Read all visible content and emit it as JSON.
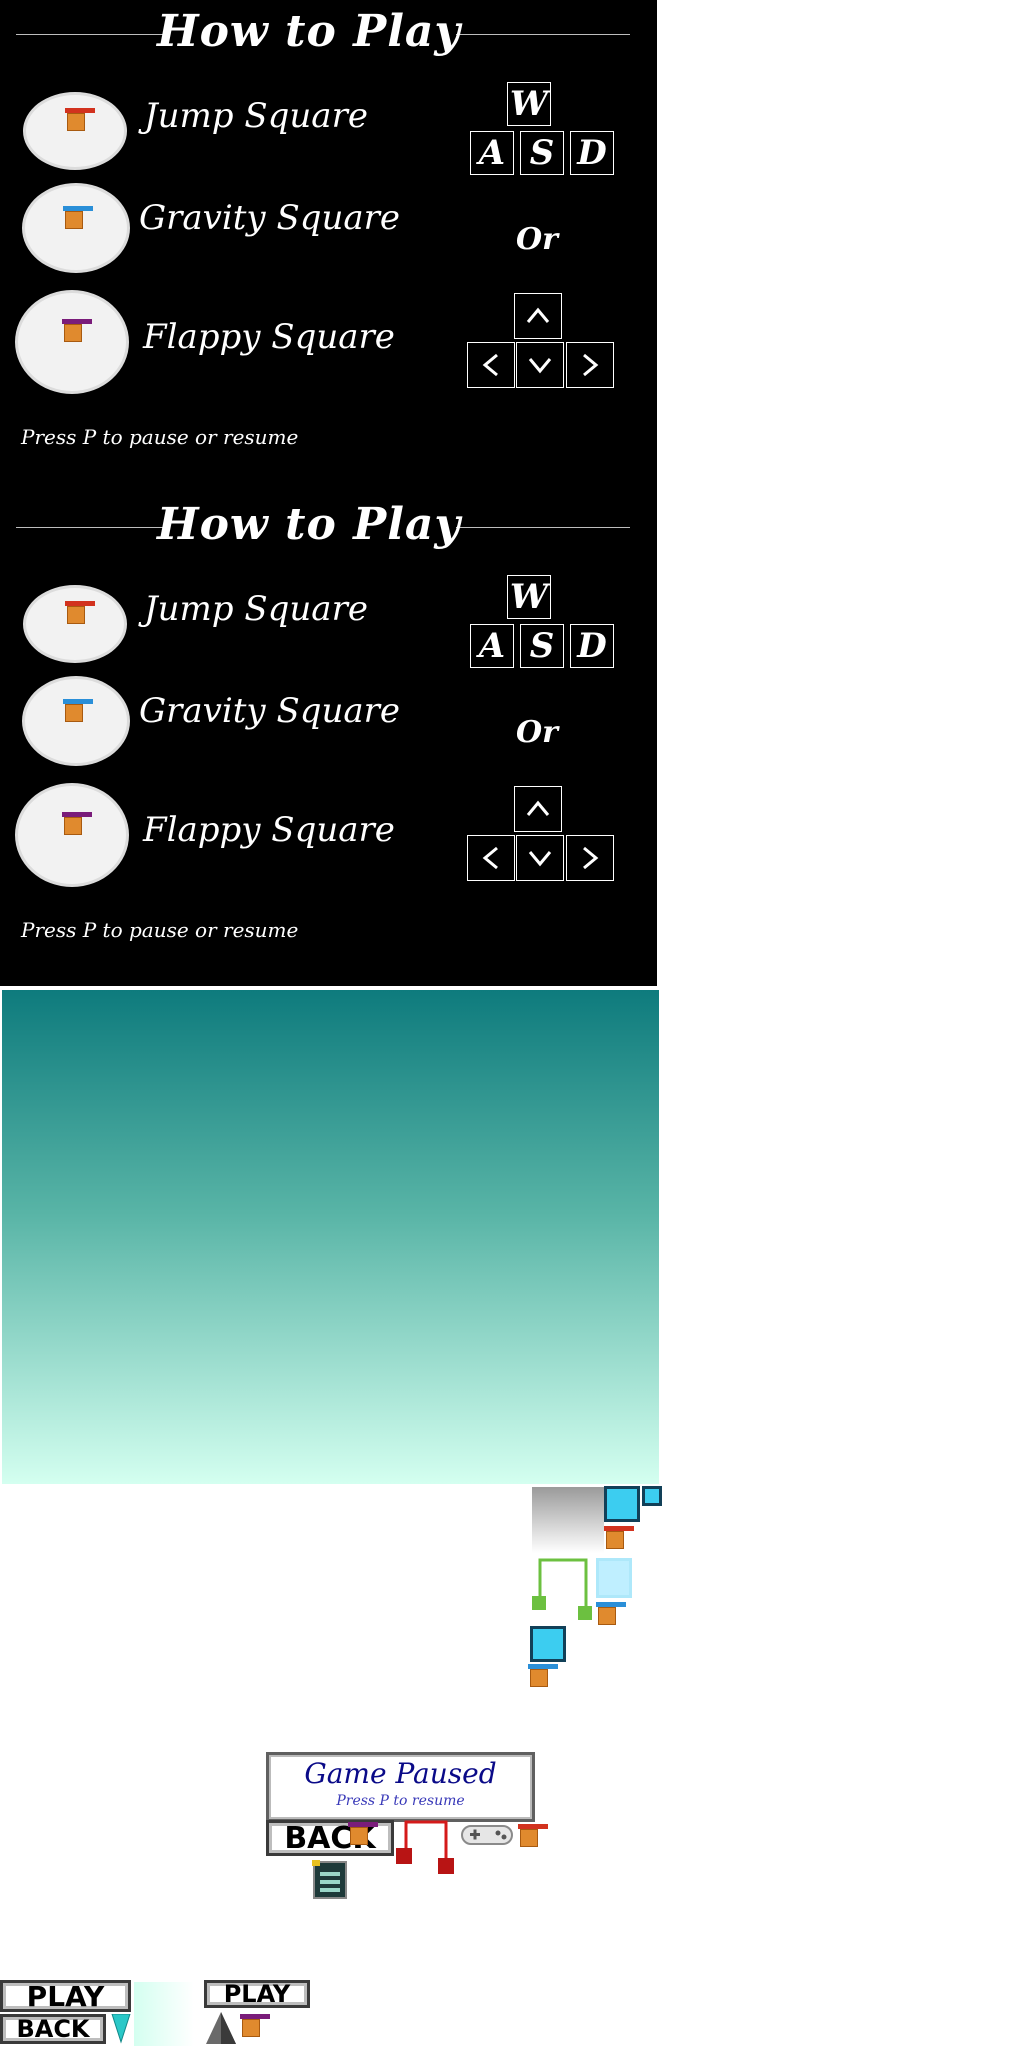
{
  "how_to_play": {
    "title": "How to Play",
    "modes": [
      {
        "label": "Jump Square",
        "cap_color": "#d2321e"
      },
      {
        "label": "Gravity Square",
        "cap_color": "#2a8fd8"
      },
      {
        "label": "Flappy Square",
        "cap_color": "#7a1c7a"
      }
    ],
    "wasd_keys": [
      "W",
      "A",
      "S",
      "D"
    ],
    "or_label": "Or",
    "arrow_keys": [
      "up-arrow-icon",
      "left-arrow-icon",
      "down-arrow-icon",
      "right-arrow-icon"
    ],
    "pause_hint": "Press P to pause or resume"
  },
  "pause_menu": {
    "title": "Game Paused",
    "subtitle": "Press P to resume"
  },
  "buttons": {
    "back_label": "BACK",
    "play_label": "PLAY"
  },
  "colors": {
    "panel_bg": "#000000",
    "sky_top": "#0e7b7d",
    "sky_bottom": "#d4fff0",
    "square_body": "#e08a2e",
    "ice": "#3ccdf0"
  }
}
